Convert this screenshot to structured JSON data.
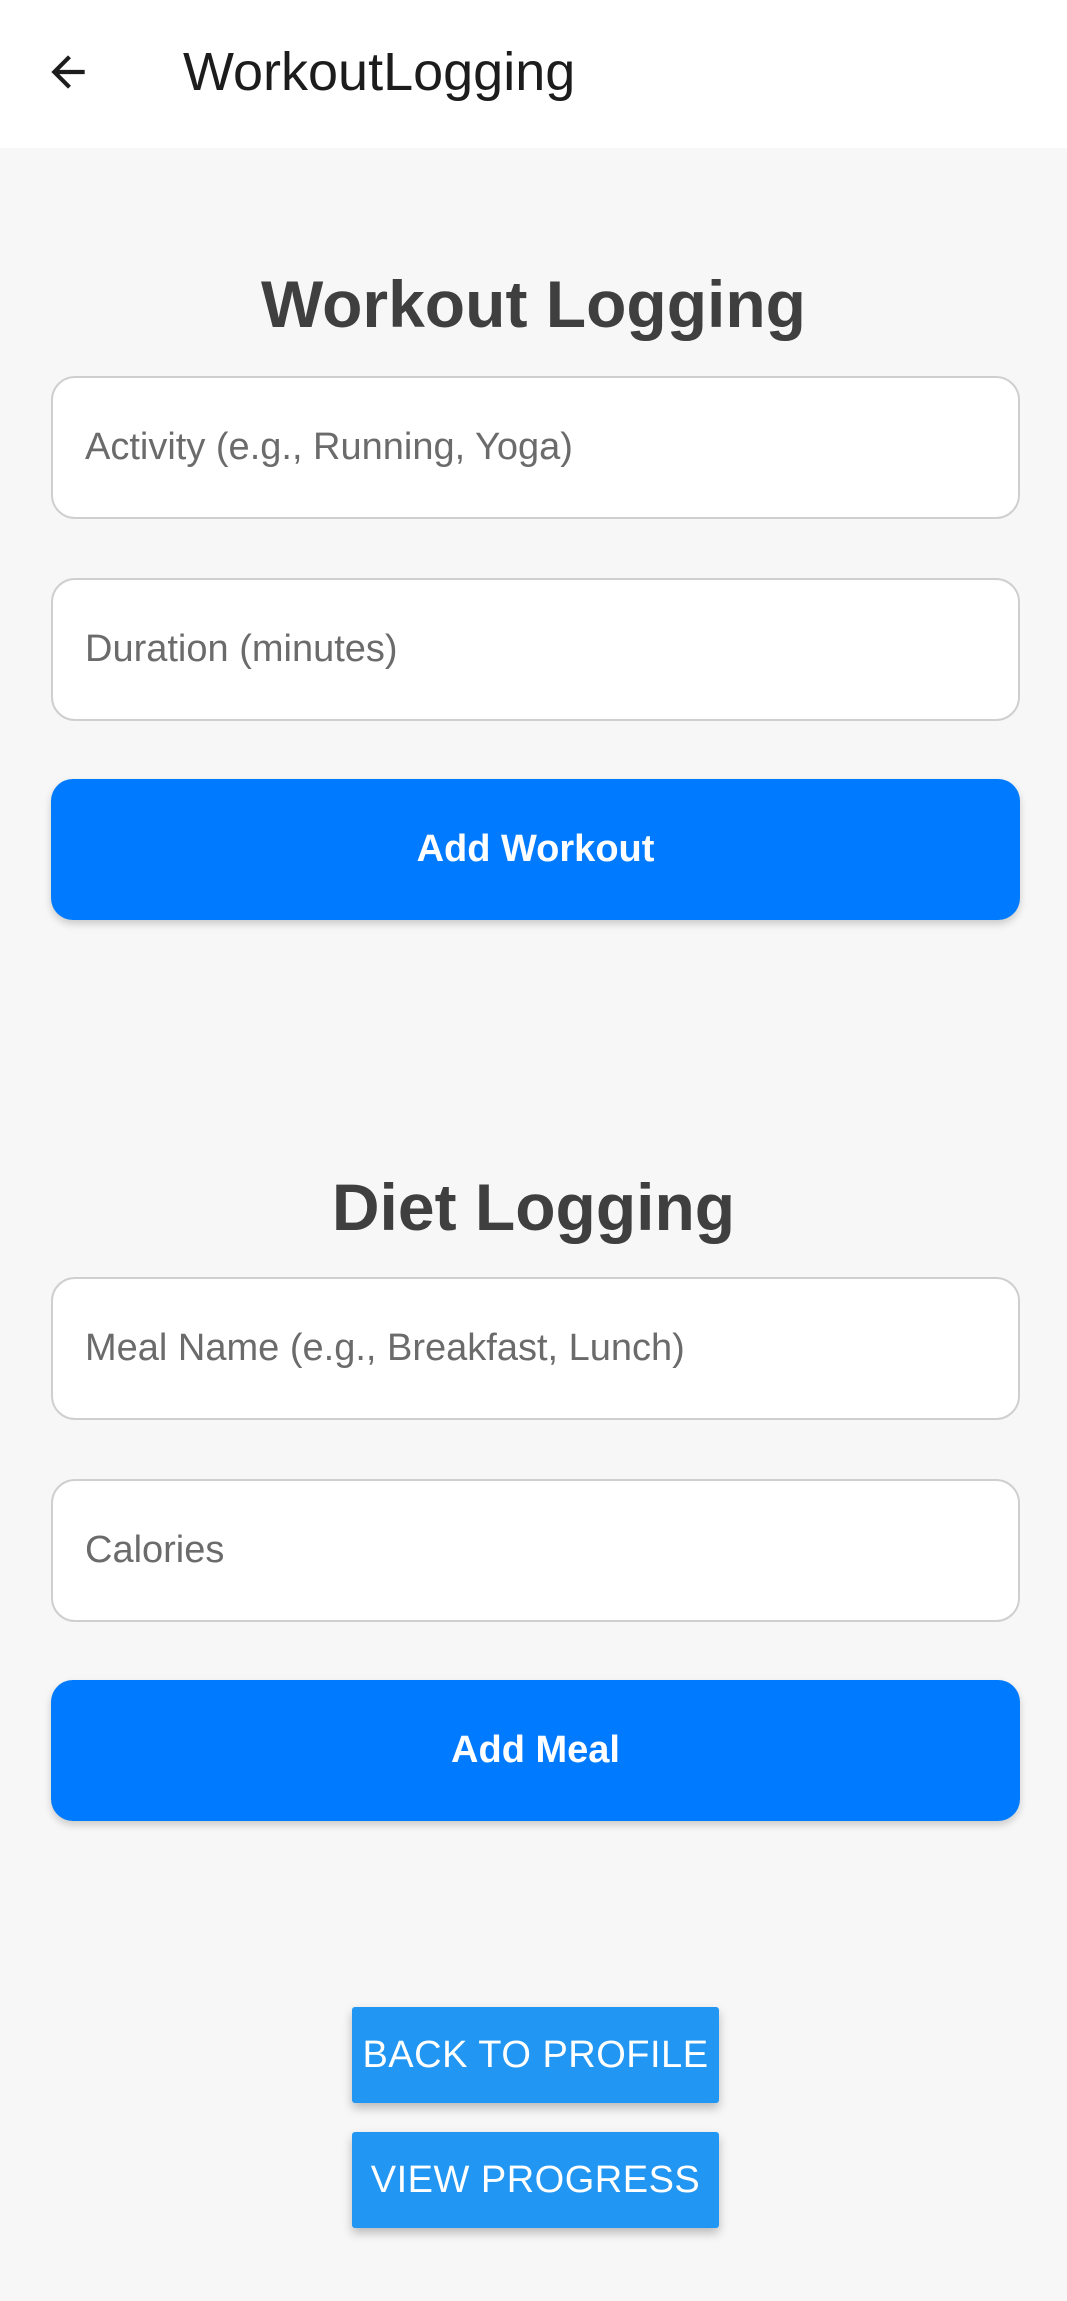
{
  "app_bar": {
    "title": "WorkoutLogging",
    "back_icon": "arrow-left-icon"
  },
  "workout": {
    "title": "Workout Logging",
    "activity_placeholder": "Activity (e.g., Running, Yoga)",
    "activity_value": "",
    "duration_placeholder": "Duration (minutes)",
    "duration_value": "",
    "add_label": "Add Workout"
  },
  "diet": {
    "title": "Diet Logging",
    "meal_placeholder": "Meal Name (e.g., Breakfast, Lunch)",
    "meal_value": "",
    "calories_placeholder": "Calories",
    "calories_value": "",
    "add_label": "Add Meal"
  },
  "nav": {
    "back_to_profile_label": "BACK TO PROFILE",
    "view_progress_label": "VIEW PROGRESS"
  },
  "colors": {
    "primary_button": "#007bff",
    "secondary_button": "#2196f3",
    "background": "#f7f7f7",
    "heading": "#3f3f3f"
  }
}
